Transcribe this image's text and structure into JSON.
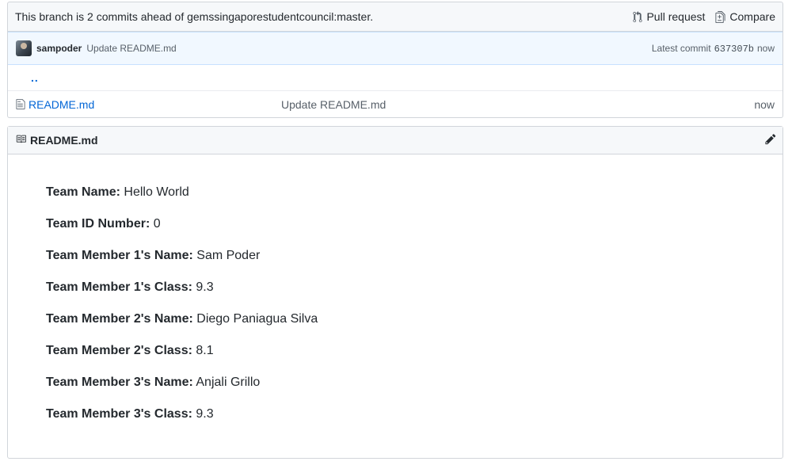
{
  "branch_bar": {
    "text": "This branch is 2 commits ahead of gemssingaporestudentcouncil:master.",
    "pull_request_label": "Pull request",
    "compare_label": "Compare"
  },
  "commit": {
    "author": "sampoder",
    "message": "Update README.md",
    "latest_label": "Latest commit",
    "sha": "637307b",
    "age": "now"
  },
  "parent_link": "..",
  "files": [
    {
      "name": "README.md",
      "message": "Update README.md",
      "age": "now"
    }
  ],
  "readme": {
    "title": "README.md",
    "lines": [
      {
        "label": "Team Name:",
        "value": "Hello World"
      },
      {
        "label": "Team ID Number:",
        "value": "0"
      },
      {
        "label": "Team Member 1's Name:",
        "value": "Sam Poder"
      },
      {
        "label": "Team Member 1's Class:",
        "value": "9.3"
      },
      {
        "label": "Team Member 2's Name:",
        "value": "Diego Paniagua Silva"
      },
      {
        "label": "Team Member 2's Class:",
        "value": "8.1"
      },
      {
        "label": "Team Member 3's Name:",
        "value": "Anjali Grillo"
      },
      {
        "label": "Team Member 3's Class:",
        "value": "9.3"
      }
    ]
  },
  "colors": {
    "link": "#0366d6",
    "commit_bg": "#f1f8ff",
    "header_bg": "#f6f8fa",
    "border": "#d1d5da"
  },
  "icons": {
    "pull_request": "git-pull-request-icon",
    "compare": "diff-icon",
    "file": "file-icon",
    "book": "book-icon",
    "edit": "pencil-icon"
  }
}
